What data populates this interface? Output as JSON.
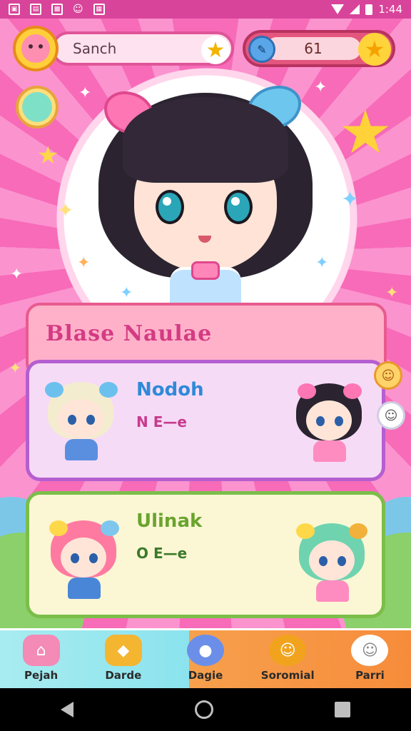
{
  "status_bar": {
    "time": "1:44",
    "notification_icons": [
      "photo-icon",
      "calendar-icon",
      "gallery-icon",
      "cat-icon",
      "clipboard-icon"
    ]
  },
  "top_bar": {
    "search_text": "Sanch",
    "currency_value": "61"
  },
  "panel": {
    "title": "Blase Naulae"
  },
  "cards": [
    {
      "name": "Nodoh",
      "sub": "N E—e",
      "accent": "#b45fd0"
    },
    {
      "name": "Ulinak",
      "sub": "O E—e",
      "accent": "#7bbe4a"
    }
  ],
  "bottom_nav": [
    {
      "label": "Pejah",
      "icon": "house-icon",
      "color": "#f48ab6"
    },
    {
      "label": "Darde",
      "icon": "cake-icon",
      "color": "#f4b531"
    },
    {
      "label": "Dagie",
      "icon": "blob-icon",
      "color": "#6b8fe8"
    },
    {
      "label": "Soromial",
      "icon": "mascot-icon",
      "color": "#f2a31e"
    },
    {
      "label": "Parri",
      "icon": "ghost-icon",
      "color": "#ffffff"
    }
  ],
  "colors": {
    "brand_pink": "#f47ec0",
    "status_bar": "#d8449a"
  }
}
